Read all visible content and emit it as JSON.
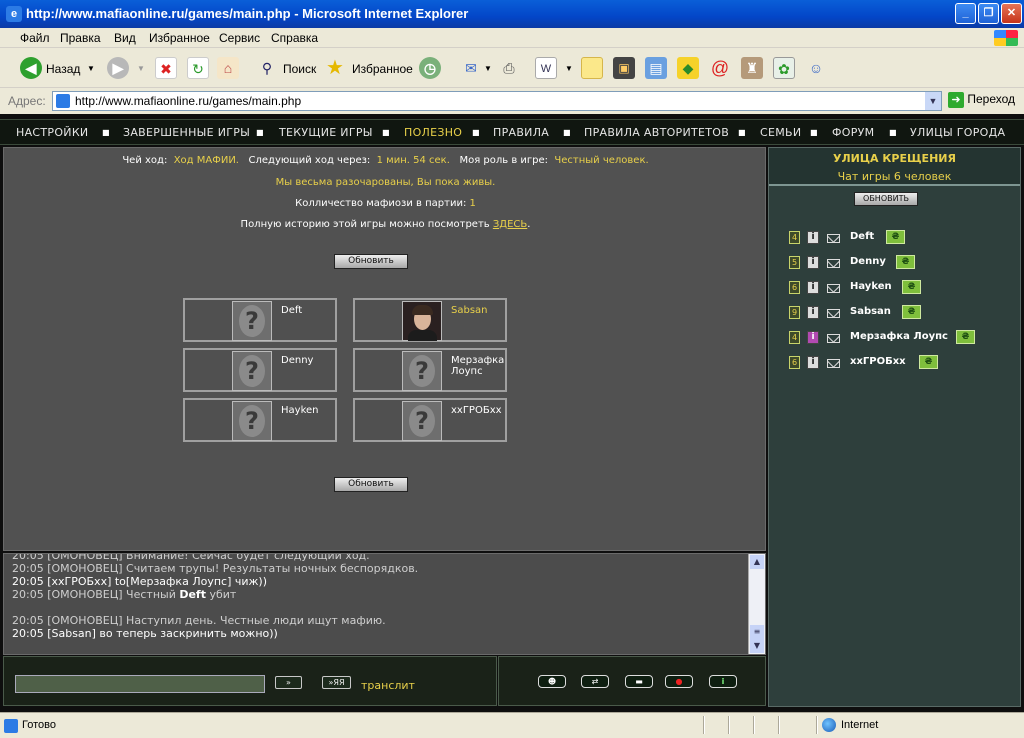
{
  "window": {
    "title": "http://www.mafiaonline.ru/games/main.php - Microsoft Internet Explorer"
  },
  "menu": [
    "Файл",
    "Правка",
    "Вид",
    "Избранное",
    "Сервис",
    "Справка"
  ],
  "toolbar": {
    "back_label": "Назад",
    "search_label": "Поиск",
    "favorites_label": "Избранное"
  },
  "address": {
    "label": "Адрес:",
    "url": "http://www.mafiaonline.ru/games/main.php",
    "go_label": "Переход"
  },
  "nav": [
    {
      "label": "НАСТРОЙКИ"
    },
    {
      "label": "ЗАВЕРШЕННЫЕ ИГРЫ"
    },
    {
      "label": "ТЕКУЩИЕ ИГРЫ"
    },
    {
      "label": "ПОЛЕЗНО"
    },
    {
      "label": "ПРАВИЛА"
    },
    {
      "label": "ПРАВИЛА АВТОРИТЕТОВ"
    },
    {
      "label": "СЕМЬИ"
    },
    {
      "label": "ФОРУМ"
    },
    {
      "label": "УЛИЦЫ ГОРОДА"
    }
  ],
  "game": {
    "turn_label": "Чей ход:",
    "turn_value": "Ход МАФИИ.",
    "next_label": "Следующий ход через:",
    "next_value": "1 мин. 54 сек.",
    "role_label": "Моя роль в игре:",
    "role_value": "Честный человек.",
    "message": "Мы весьма разочарованы, Вы пока живы.",
    "mafia_count_label": "Колличество мафиози в партии:",
    "mafia_count": "1",
    "history_text": "Полную историю этой игры можно посмотреть",
    "history_link": "ЗДЕСЬ",
    "history_end": ".",
    "refresh_label": "Обновить"
  },
  "players_grid": [
    {
      "name": "Deft"
    },
    {
      "name": "Sabsan"
    },
    {
      "name": "Denny"
    },
    {
      "name": "Мерзафка Лоупс"
    },
    {
      "name": "Hayken"
    },
    {
      "name": "xxГРОБxx"
    }
  ],
  "chat": [
    {
      "time": "20:05",
      "text": " [ОМОНОВЕЦ] Внимание! Сейчас будет следующий ход."
    },
    {
      "time": "20:05",
      "text": " [ОМОНОВЕЦ] Считаем трупы! Результаты ночных беспорядков."
    },
    {
      "time": "20:05",
      "text": " [xxГРОБxx] to[Мерзафка Лоупс] чиж))"
    },
    {
      "time": "20:05",
      "text_a": " [ОМОНОВЕЦ] Честный ",
      "bold": "Deft",
      "text_b": " убит"
    },
    {
      "time": "20:05",
      "text": " [ОМОНОВЕЦ] Наступил день. Честные люди ищут мафию."
    },
    {
      "time": "20:05",
      "text": " [Sabsan] во теперь заскринить можно))"
    }
  ],
  "input": {
    "send_label": "»",
    "send_ya_label": "»ЯЯ",
    "translit_label": "транслит"
  },
  "actions": {
    "smile": "☻",
    "refresh": "⇄",
    "gun": "▬",
    "record": "●",
    "info": "i"
  },
  "sidebar": {
    "street": "УЛИЦА КРЕЩЕНИЯ",
    "chat_info": "Чат игры 6 человек",
    "refresh_label": "ОБНОВИТЬ",
    "players": [
      {
        "level": "4",
        "name": "Deft",
        "info_pink": false
      },
      {
        "level": "5",
        "name": "Denny",
        "info_pink": false
      },
      {
        "level": "6",
        "name": "Hayken",
        "info_pink": false
      },
      {
        "level": "9",
        "name": "Sabsan",
        "info_pink": false
      },
      {
        "level": "4",
        "name": "Мерзафка Лоупс",
        "info_pink": true
      },
      {
        "level": "6",
        "name": "xxГРОБxx",
        "info_pink": false
      }
    ]
  },
  "status": {
    "text": "Готово",
    "zone": "Internet"
  },
  "colors": {
    "accent_yellow": "#e8d04a",
    "panel_gray": "#515151",
    "side_panel": "#2e3f3c"
  }
}
